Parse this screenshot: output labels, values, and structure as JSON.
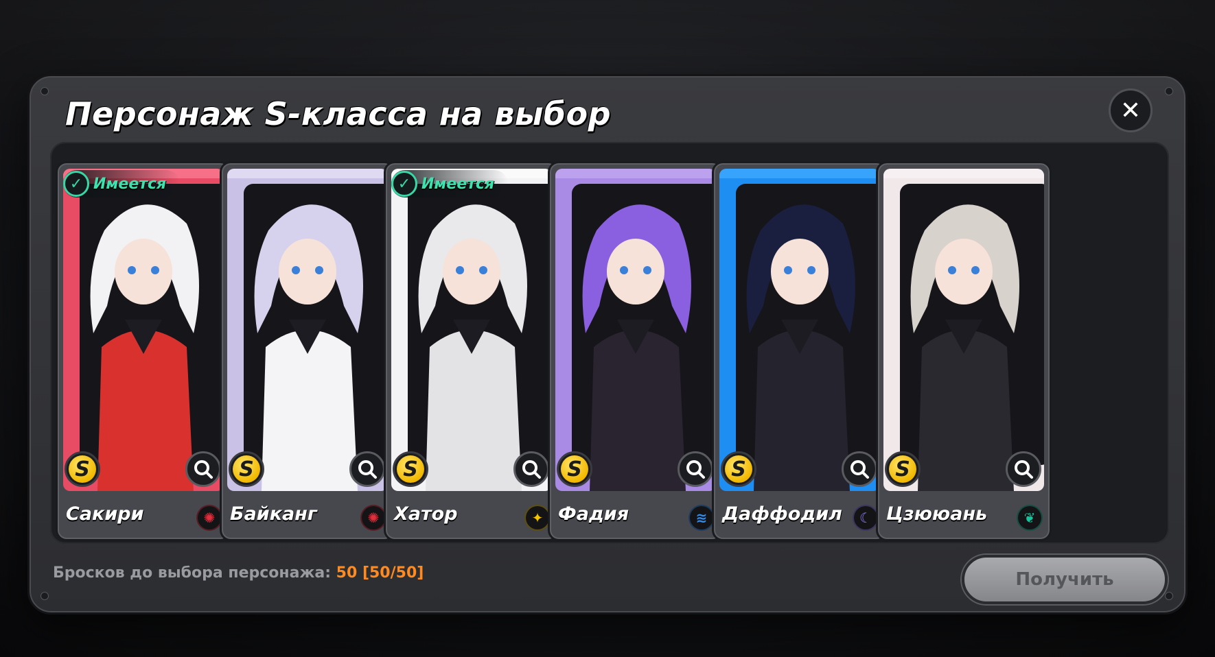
{
  "dialog": {
    "title": "Персонаж S-класса на выбор",
    "close_icon": "close-icon",
    "footer_label": "Бросков до выбора персонажа:",
    "footer_value": "50 [50/50]",
    "claim_label": "Получить"
  },
  "owned_label": "Имеется",
  "rank_letter": "S",
  "cards": [
    {
      "name": "Сакири",
      "owned": true,
      "bg": "#e84c64",
      "accent": "#ff8aa0",
      "attribute_icon": "burst-icon",
      "attribute_color": "#e0303e",
      "attribute_glyph": "✺"
    },
    {
      "name": "Байканг",
      "owned": false,
      "bg": "#c9c2e6",
      "accent": "#eeeaf8",
      "attribute_icon": "burst-icon",
      "attribute_color": "#e0303e",
      "attribute_glyph": "✺"
    },
    {
      "name": "Хатор",
      "owned": true,
      "bg": "#f3f3f5",
      "accent": "#ffffff",
      "attribute_icon": "star-icon",
      "attribute_color": "#f2c400",
      "attribute_glyph": "✦"
    },
    {
      "name": "Фадия",
      "owned": false,
      "bg": "#a98be6",
      "accent": "#c8b1f4",
      "attribute_icon": "wave-icon",
      "attribute_color": "#2f8cf0",
      "attribute_glyph": "≋"
    },
    {
      "name": "Даффодил",
      "owned": false,
      "bg": "#1f8ef2",
      "accent": "#4ab0ff",
      "attribute_icon": "moon-icon",
      "attribute_color": "#8c7cf0",
      "attribute_glyph": "☾"
    },
    {
      "name": "Цзююань",
      "owned": false,
      "bg": "#f1e8ea",
      "accent": "#fbf5f6",
      "attribute_icon": "leaf-icon",
      "attribute_color": "#18c29a",
      "attribute_glyph": "❦"
    }
  ]
}
